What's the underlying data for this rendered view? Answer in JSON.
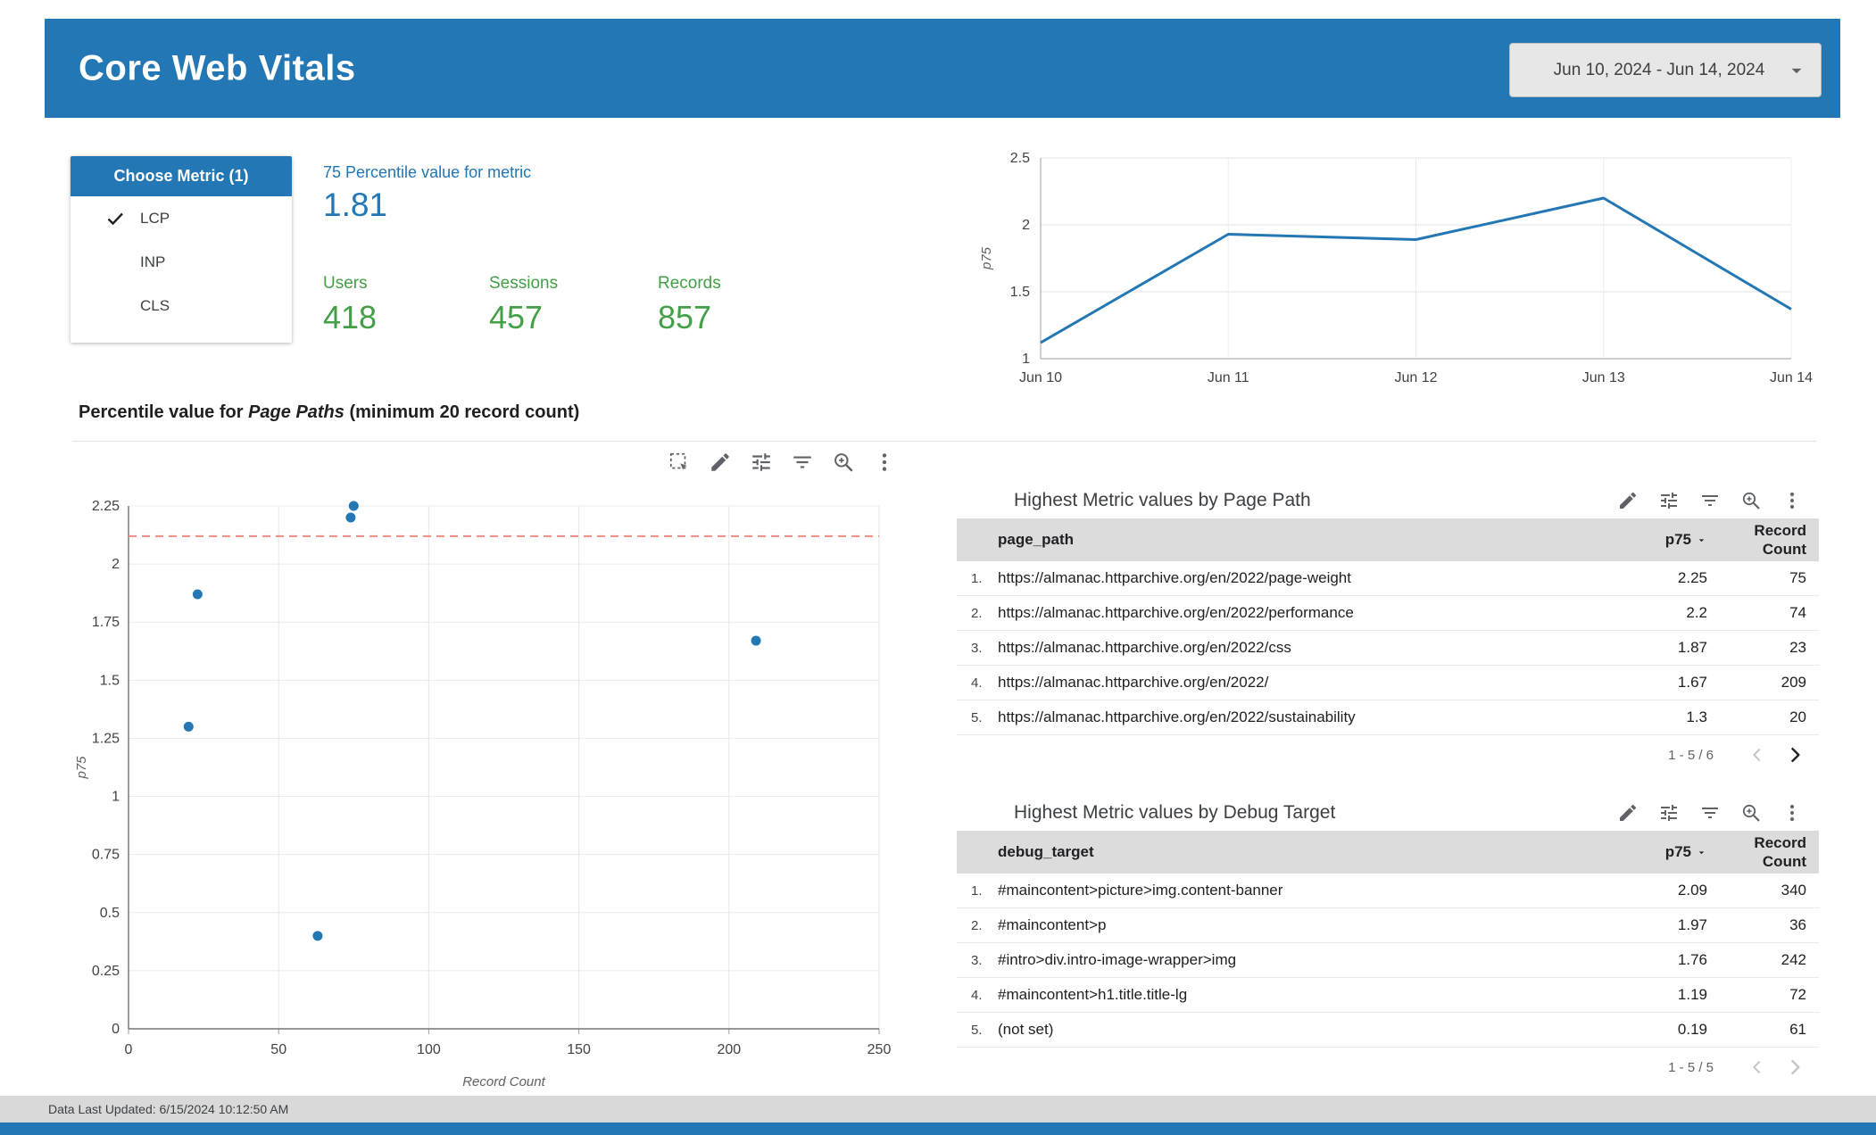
{
  "header": {
    "title": "Core Web Vitals",
    "date_range": "Jun 10, 2024 - Jun 14, 2024"
  },
  "colors": {
    "primary": "#2277b4",
    "green": "#43a047",
    "line": "#2277b4",
    "point": "#2277b4",
    "ref_line": "#f08a80",
    "table_header_bg": "#dcdcdc"
  },
  "metric_panel": {
    "title": "Choose Metric (1)",
    "options": [
      {
        "label": "LCP",
        "checked": true
      },
      {
        "label": "INP",
        "checked": false
      },
      {
        "label": "CLS",
        "checked": false
      }
    ]
  },
  "scorecards": {
    "percentile": {
      "label": "75 Percentile value for metric",
      "value": "1.81"
    },
    "kpis": [
      {
        "label": "Users",
        "value": "418"
      },
      {
        "label": "Sessions",
        "value": "457"
      },
      {
        "label": "Records",
        "value": "857"
      }
    ]
  },
  "scatter_section": {
    "title_prefix": "Percentile value for ",
    "title_italic": "Page Paths",
    "title_suffix": " (minimum 20 record count)"
  },
  "chart_toolbar": [
    "marquee-select",
    "edit",
    "tune",
    "filter",
    "zoom-in",
    "more-vert"
  ],
  "table_toolbar": [
    "edit",
    "tune",
    "filter",
    "zoom-in",
    "more-vert"
  ],
  "chart_data": [
    {
      "name": "p75 over time",
      "type": "line",
      "x": [
        "Jun 10",
        "Jun 11",
        "Jun 12",
        "Jun 13",
        "Jun 14"
      ],
      "series": [
        {
          "name": "p75",
          "values": [
            1.12,
            1.93,
            1.89,
            2.2,
            1.37
          ]
        }
      ],
      "ylabel": "p75",
      "ylim": [
        1,
        2.5
      ],
      "yticks": [
        1,
        1.5,
        2,
        2.5
      ],
      "grid": true,
      "legend": "none"
    },
    {
      "name": "p75 by record count",
      "type": "scatter",
      "xlabel": "Record Count",
      "ylabel": "p75",
      "xlim": [
        0,
        250
      ],
      "xticks": [
        0,
        50,
        100,
        150,
        200,
        250
      ],
      "ylim": [
        0,
        2.25
      ],
      "ytick_step": 0.25,
      "points": [
        [
          75,
          2.25
        ],
        [
          74,
          2.2
        ],
        [
          23,
          1.87
        ],
        [
          209,
          1.67
        ],
        [
          20,
          1.3
        ],
        [
          63,
          0.4
        ]
      ],
      "reference_line_y": 2.12,
      "grid": true
    }
  ],
  "tables": [
    {
      "title": "Highest Metric values by Page Path",
      "dim_header": "page_path",
      "metric_header": "p75",
      "count_header": "Record Count",
      "rows": [
        [
          "1.",
          "https://almanac.httparchive.org/en/2022/page-weight",
          "2.25",
          "75"
        ],
        [
          "2.",
          "https://almanac.httparchive.org/en/2022/performance",
          "2.2",
          "74"
        ],
        [
          "3.",
          "https://almanac.httparchive.org/en/2022/css",
          "1.87",
          "23"
        ],
        [
          "4.",
          "https://almanac.httparchive.org/en/2022/",
          "1.67",
          "209"
        ],
        [
          "5.",
          "https://almanac.httparchive.org/en/2022/sustainability",
          "1.3",
          "20"
        ]
      ],
      "pagination": "1 - 5 / 6",
      "prev_enabled": false,
      "next_enabled": true
    },
    {
      "title": "Highest Metric values by Debug Target",
      "dim_header": "debug_target",
      "metric_header": "p75",
      "count_header": "Record Count",
      "rows": [
        [
          "1.",
          "#maincontent>picture>img.content-banner",
          "2.09",
          "340"
        ],
        [
          "2.",
          "#maincontent>p",
          "1.97",
          "36"
        ],
        [
          "3.",
          "#intro>div.intro-image-wrapper>img",
          "1.76",
          "242"
        ],
        [
          "4.",
          "#maincontent>h1.title.title-lg",
          "1.19",
          "72"
        ],
        [
          "5.",
          "(not set)",
          "0.19",
          "61"
        ]
      ],
      "pagination": "1 - 5 / 5",
      "prev_enabled": false,
      "next_enabled": false
    }
  ],
  "footer": {
    "last_updated": "Data Last Updated: 6/15/2024 10:12:50 AM"
  }
}
